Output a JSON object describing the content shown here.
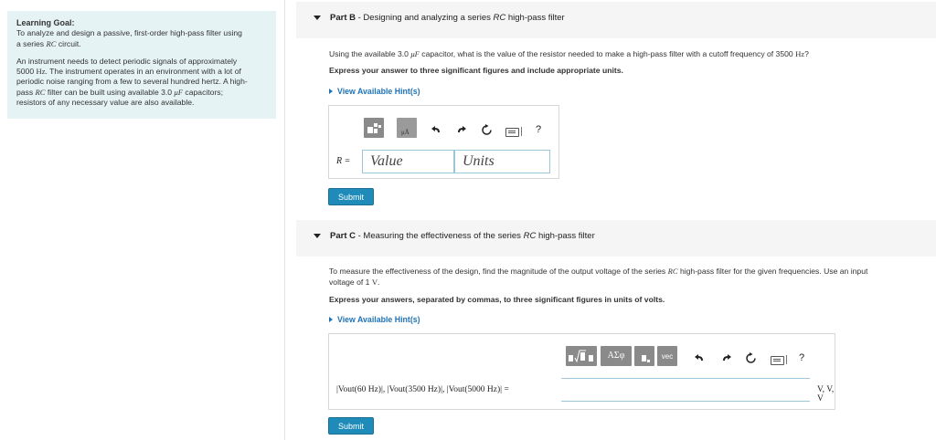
{
  "goal": {
    "title": "Learning Goal:",
    "line1": "To analyze and design a passive, first-order high-pass filter using",
    "line2a": "a series ",
    "line2b": "RC",
    "line2c": " circuit.",
    "p2l1": "An instrument needs to detect periodic signals of approximately",
    "p2l2a": "5000 ",
    "p2l2b": "Hz",
    "p2l2c": ". The instrument operates in an environment with a lot of",
    "p2l3": "periodic noise ranging from a few to several hundred hertz. A high-",
    "p2l4a": "pass ",
    "p2l4b": "RC",
    "p2l4c": " filter can be built using available 3.0 ",
    "p2l4d": "μF",
    "p2l4e": " capacitors;",
    "p2l5": "resistors of any necessary value are also available."
  },
  "partB": {
    "label": "Part B",
    "title_pre": " - Designing and analyzing a series ",
    "title_rc": "RC",
    "title_post": " high-pass filter",
    "q_pre": "Using the available 3.0 ",
    "q_unit": "μF",
    "q_mid": " capacitor, what is the value of the resistor needed to make a high-pass filter with a cutoff frequency of 3500 ",
    "q_hz": "Hz",
    "q_end": "?",
    "instruction": "Express your answer to three significant figures and include appropriate units.",
    "hint": "View Available Hint(s)",
    "var_label": "R =",
    "value_placeholder": "Value",
    "units_placeholder": "Units",
    "help": "?",
    "submit": "Submit"
  },
  "partC": {
    "label": "Part C",
    "title_pre": " - Measuring the effectiveness of the series ",
    "title_rc": "RC",
    "title_post": " high-pass filter",
    "q1_pre": "To measure the effectiveness of the design, find the magnitude of the output voltage of the series ",
    "q1_rc": "RC",
    "q1_post": " high-pass filter for the given frequencies. Use an input",
    "q2_pre": "voltage of 1 ",
    "q2_v": "V",
    "q2_post": ".",
    "instruction": "Express your answers, separated by commas, to three significant figures in units of volts.",
    "hint": "View Available Hint(s)",
    "expr": "|Vout(60 Hz)|, |Vout(3500 Hz)|, |Vout(5000 Hz)| =",
    "units": "V, V, V",
    "sym_label": "ΑΣφ",
    "vec_label": "vec",
    "help": "?",
    "submit": "Submit"
  }
}
